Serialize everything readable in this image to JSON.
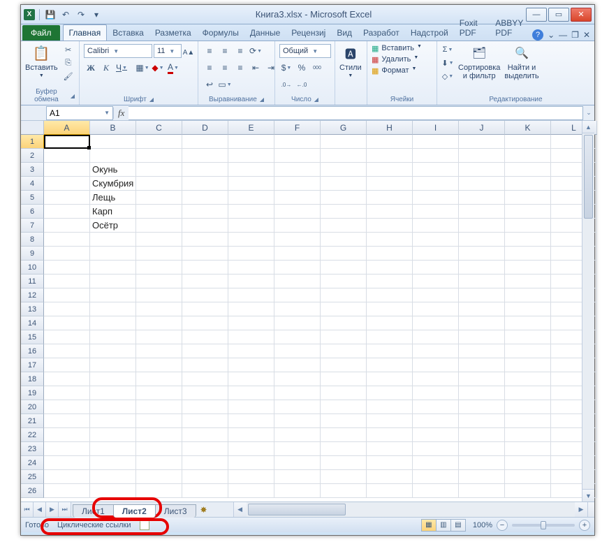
{
  "window": {
    "title": "Книга3.xlsx  -  Microsoft Excel"
  },
  "ribbon": {
    "file_tab": "Файл",
    "tabs": [
      "Главная",
      "Вставка",
      "Разметка",
      "Формулы",
      "Данные",
      "Рецензиј",
      "Вид",
      "Разработ",
      "Надстрой",
      "Foxit PDF",
      "ABBYY PDF"
    ],
    "active_tab_index": 0,
    "groups": {
      "clipboard": {
        "label": "Буфер обмена",
        "paste": "Вставить"
      },
      "font": {
        "label": "Шрифт",
        "name": "Calibri",
        "size": "11",
        "bold": "Ж",
        "italic": "К",
        "underline": "Ч"
      },
      "alignment": {
        "label": "Выравнивание"
      },
      "number": {
        "label": "Число",
        "format": "Общий"
      },
      "styles": {
        "label": "",
        "styles_btn": "Стили"
      },
      "cells": {
        "label": "Ячейки",
        "insert": "Вставить",
        "delete": "Удалить",
        "format": "Формат"
      },
      "editing": {
        "label": "Редактирование",
        "sort": "Сортировка\nи фильтр",
        "find": "Найти и\nвыделить"
      }
    }
  },
  "formula_bar": {
    "name_box": "A1",
    "fx": "fx",
    "formula": ""
  },
  "grid": {
    "columns": [
      "A",
      "B",
      "C",
      "D",
      "E",
      "F",
      "G",
      "H",
      "I",
      "J",
      "K",
      "L"
    ],
    "row_count": 26,
    "active_cell": "A1",
    "data": {
      "B3": "Окунь",
      "B4": "Скумбрия",
      "B5": "Лещь",
      "B6": "Карп",
      "B7": "Осётр"
    }
  },
  "sheets": {
    "tabs": [
      "Лист1",
      "Лист2",
      "Лист3"
    ],
    "active_index": 1
  },
  "status": {
    "ready": "Готово",
    "circular": "Циклические ссылки",
    "zoom": "100%"
  }
}
